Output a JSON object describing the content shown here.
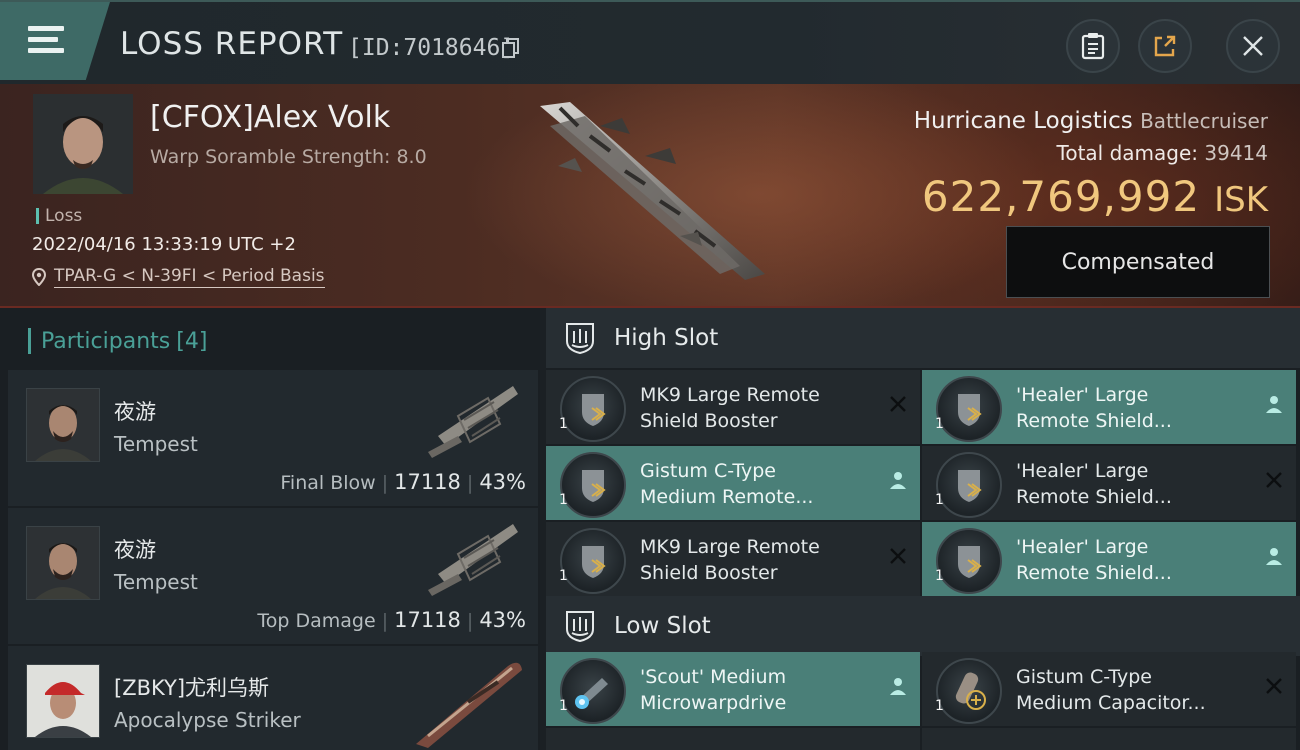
{
  "header": {
    "title": "LOSS REPORT",
    "report_id": "[ID:7018646]"
  },
  "victim": {
    "name": "[CFOX]Alex Volk",
    "warp_scramble": "Warp Soramble Strength: 8.0",
    "tag": "Loss",
    "datetime": "2022/04/16 13:33:19 UTC +2",
    "location": "TPAR-G < N-39FI < Period Basis",
    "ship_name": "Hurricane Logistics",
    "ship_class": "Battlecruiser",
    "damage_label": "Total damage:",
    "damage_value": "39414",
    "isk_value": "622,769,992",
    "isk_unit": "ISK",
    "compensated_label": "Compensated"
  },
  "participants": {
    "label": "Participants",
    "count": "[4]",
    "rows": [
      {
        "name": "夜游",
        "ship": "Tempest",
        "role": "Final Blow",
        "damage": "17118",
        "percent": "43%"
      },
      {
        "name": "夜游",
        "ship": "Tempest",
        "role": "Top Damage",
        "damage": "17118",
        "percent": "43%"
      },
      {
        "name": "[ZBKY]尤利乌斯",
        "ship": "Apocalypse Striker",
        "role": "",
        "damage": "",
        "percent": ""
      }
    ]
  },
  "slots": {
    "high_label": "High Slot",
    "low_label": "Low Slot",
    "high": [
      {
        "line1": "MK9 Large Remote",
        "line2": "Shield Booster",
        "qty": "1",
        "state": "destroyed"
      },
      {
        "line1": "'Healer' Large",
        "line2": "Remote Shield...",
        "qty": "1",
        "state": "dropped"
      },
      {
        "line1": "Gistum C-Type",
        "line2": "Medium Remote...",
        "qty": "1",
        "state": "dropped"
      },
      {
        "line1": "'Healer' Large",
        "line2": "Remote Shield...",
        "qty": "1",
        "state": "destroyed"
      },
      {
        "line1": "MK9 Large Remote",
        "line2": "Shield Booster",
        "qty": "1",
        "state": "destroyed"
      },
      {
        "line1": "'Healer' Large",
        "line2": "Remote Shield...",
        "qty": "1",
        "state": "dropped"
      }
    ],
    "low": [
      {
        "line1": "'Scout' Medium",
        "line2": "Microwarpdrive",
        "qty": "1",
        "state": "dropped"
      },
      {
        "line1": "Gistum C-Type",
        "line2": "Medium Capacitor...",
        "qty": "1",
        "state": "destroyed"
      }
    ]
  }
}
